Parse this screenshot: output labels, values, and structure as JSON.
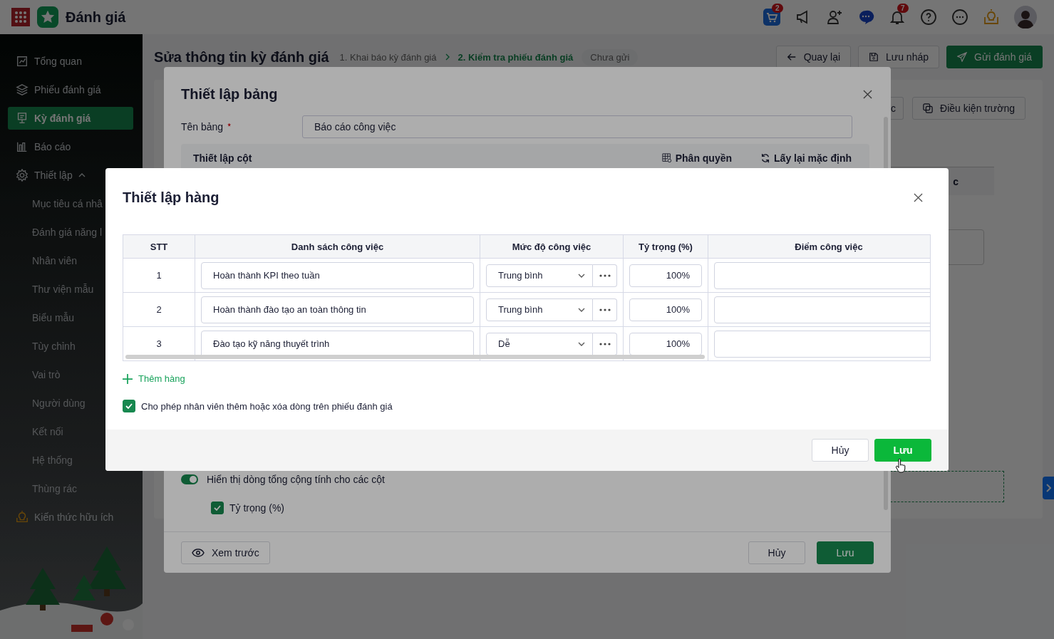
{
  "topbar": {
    "app_title": "Đánh giá",
    "cart_badge": "2",
    "bell_badge": "7"
  },
  "sidebar": {
    "items": [
      {
        "label": "Tổng quan",
        "selected": false
      },
      {
        "label": "Phiếu đánh giá",
        "selected": false
      },
      {
        "label": "Kỳ đánh giá",
        "selected": true
      },
      {
        "label": "Báo cáo",
        "selected": false
      },
      {
        "label": "Thiết lập",
        "selected": false,
        "expanded": true,
        "children": [
          {
            "label": "Mục tiêu cá nhâ",
            "selected": false
          },
          {
            "label": "Đánh giá năng l",
            "selected": false
          },
          {
            "label": "Nhân viên",
            "selected": false
          },
          {
            "label": "Thư viện mẫu",
            "selected": false
          },
          {
            "label": "Biểu mẫu",
            "selected": false
          },
          {
            "label": "Tùy chỉnh",
            "selected": false
          },
          {
            "label": "Vai trò",
            "selected": false
          },
          {
            "label": "Người dùng",
            "selected": false
          },
          {
            "label": "Kết nối",
            "selected": false
          },
          {
            "label": "Hệ thống",
            "selected": false
          },
          {
            "label": "Thùng rác",
            "selected": false
          }
        ]
      },
      {
        "label": "Kiến thức hữu ích",
        "selected": false
      }
    ]
  },
  "page": {
    "title": "Sửa thông tin kỳ đánh giá",
    "steps": [
      {
        "label": "1. Khai báo kỳ đánh giá",
        "selected": false
      },
      {
        "label": "2. Kiểm tra phiếu đánh giá",
        "selected": true
      }
    ],
    "status": "Chưa gửi",
    "actions": [
      "Quay lại",
      "Lưu nháp",
      "Gửi đánh giá"
    ]
  },
  "card": {
    "buttons": [
      "c",
      "Điều kiện trường"
    ],
    "column_header": "c"
  },
  "table_setup_dialog": {
    "title": "Thiết lập bảng",
    "name_label": "Tên bảng",
    "required": true,
    "name_value": "Báo cáo công việc",
    "section_title": "Thiết lập cột",
    "section_actions": [
      "Phân quyền",
      "Lấy lại mặc định"
    ],
    "total_row_toggle": {
      "label": "Hiển thị dòng tổng cộng tính cho các cột",
      "on": true
    },
    "total_columns": [
      {
        "label": "Tỷ trọng (%)",
        "checked": true
      }
    ],
    "preview_button": "Xem trước",
    "buttons": [
      "Hủy",
      "Lưu"
    ]
  },
  "row_setup_dialog": {
    "title": "Thiết lập hàng",
    "columns": [
      "STT",
      "Danh sách công việc",
      "Mức độ công việc",
      "Tỷ trọng (%)",
      "Điểm công việc"
    ],
    "rows": [
      {
        "stt": "1",
        "task": "Hoàn thành KPI theo tuần",
        "difficulty": "Trung bình",
        "weight": "100%"
      },
      {
        "stt": "2",
        "task": "Hoàn thành đào tạo an toàn thông tin",
        "difficulty": "Trung bình",
        "weight": "100%"
      },
      {
        "stt": "3",
        "task": "Đào tạo kỹ năng thuyết trình",
        "difficulty": "Dễ",
        "weight": "100%"
      }
    ],
    "add_row": "Thêm hàng",
    "allow_edit": {
      "label": "Cho phép nhân viên thêm hoặc xóa dòng trên phiếu đánh giá",
      "checked": true
    },
    "buttons": [
      "Hủy",
      "Lưu"
    ]
  }
}
